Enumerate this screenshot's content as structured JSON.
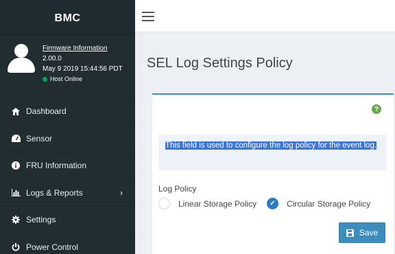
{
  "app": {
    "brand": "BMC"
  },
  "user_panel": {
    "firmware_link": "Firmware Information",
    "version": "2.00.0",
    "build_date": "May 9 2019 15:44:56 PDT",
    "host_status": "Host Online",
    "host_status_color": "#00a65a"
  },
  "sidebar": {
    "items": [
      {
        "label": "Dashboard",
        "icon": "home-icon"
      },
      {
        "label": "Sensor",
        "icon": "dashboard-gauge-icon"
      },
      {
        "label": "FRU Information",
        "icon": "info-circle-icon"
      },
      {
        "label": "Logs & Reports",
        "icon": "bar-chart-icon"
      },
      {
        "label": "Settings",
        "icon": "gear-icon"
      },
      {
        "label": "Power Control",
        "icon": "power-icon"
      }
    ]
  },
  "page": {
    "title": "SEL Log Settings Policy",
    "info_text": "This field is used to configure the log policy for the event log.",
    "log_policy_label": "Log Policy",
    "options": [
      {
        "label": "Linear Storage Policy",
        "selected": false
      },
      {
        "label": "Circular Storage Policy",
        "selected": true
      }
    ],
    "save_label": "Save"
  },
  "colors": {
    "sidebar_bg": "#222d32",
    "accent": "#3c8dbc",
    "help_icon": "#6aa84f"
  }
}
